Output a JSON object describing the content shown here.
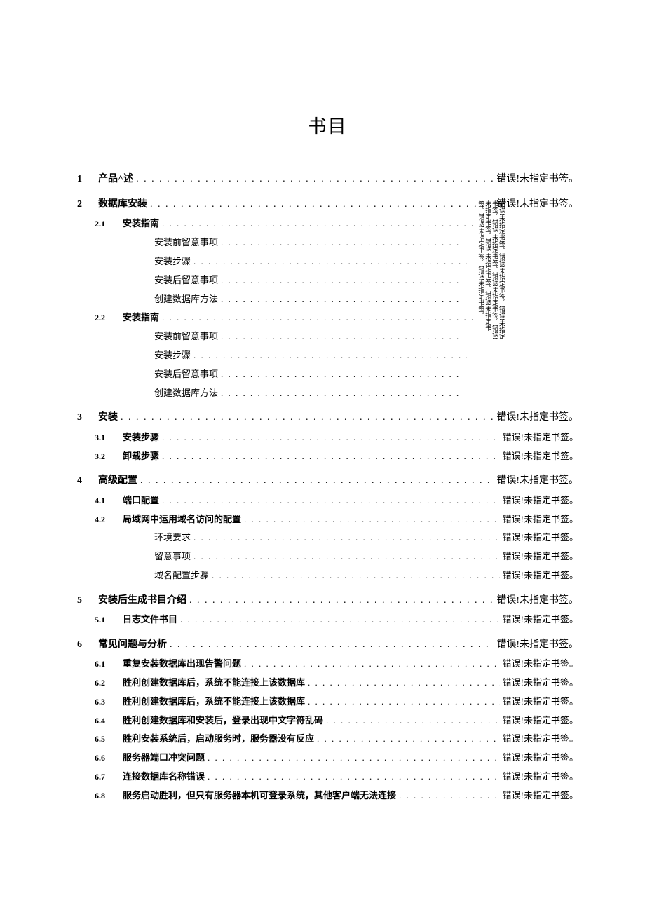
{
  "title": "书目",
  "err": "错误!未指定书签。",
  "vertical_text": "错误!未指定书签。错误!未指定书签。错误!未指定书签。错误!未指定书签。错误!未指定书签。错误!未指定书签。错误!未指定书签。错误!未指定书签。错误!未指定书签。错误!未指定书签。",
  "toc": {
    "s1": {
      "num": "1",
      "label": "产品^述"
    },
    "s2": {
      "num": "2",
      "label": "数据库安装"
    },
    "s21": {
      "num": "2.1",
      "label": "安装指南"
    },
    "s211": {
      "label": "安装前留意事项"
    },
    "s212": {
      "label": "安装步骤"
    },
    "s213": {
      "label": "安装后留意事项"
    },
    "s214": {
      "label": "创建数据库方法"
    },
    "s22": {
      "num": "2.2",
      "label": "安装指南"
    },
    "s221": {
      "label": "安装前留意事项"
    },
    "s222": {
      "label": "安装步骤"
    },
    "s223": {
      "label": "安装后留意事项"
    },
    "s224": {
      "label": "创建数据库方法"
    },
    "s3": {
      "num": "3",
      "label": "安装"
    },
    "s31": {
      "num": "3.1",
      "label": "安装步骤"
    },
    "s32": {
      "num": "3.2",
      "label": "卸载步骤"
    },
    "s4": {
      "num": "4",
      "label": "高级配置"
    },
    "s41": {
      "num": "4.1",
      "label": "端口配置"
    },
    "s42": {
      "num": "4.2",
      "label": "局域网中运用域名访问的配置"
    },
    "s421": {
      "label": "环境要求"
    },
    "s422": {
      "label": "留意事项"
    },
    "s423": {
      "label": "域名配置步骤"
    },
    "s5": {
      "num": "5",
      "label": "安装后生成书目介绍"
    },
    "s51": {
      "num": "5.1",
      "label": "日志文件书目"
    },
    "s6": {
      "num": "6",
      "label": "常见问题与分析"
    },
    "s61": {
      "num": "6.1",
      "label": "重复安装数据库出现告警问题"
    },
    "s62": {
      "num": "6.2",
      "label": "胜利创建数据库后，系统不能连接上该数据库"
    },
    "s63": {
      "num": "6.3",
      "label": "胜利创建数据库后，系统不能连接上该数据库"
    },
    "s64": {
      "num": "6.4",
      "label": "胜利创建数据库和安装后，登录出现中文字符乱码"
    },
    "s65": {
      "num": "6.5",
      "label": "胜利安装系统后，启动服务时，服务器没有反应"
    },
    "s66": {
      "num": "6.6",
      "label": "服务器端口冲突问题"
    },
    "s67": {
      "num": "6.7",
      "label": "连接数据库名称错误"
    },
    "s68": {
      "num": "6.8",
      "label": "服务启动胜利，但只有服务器本机可登录系统，其他客户端无法连接"
    }
  }
}
